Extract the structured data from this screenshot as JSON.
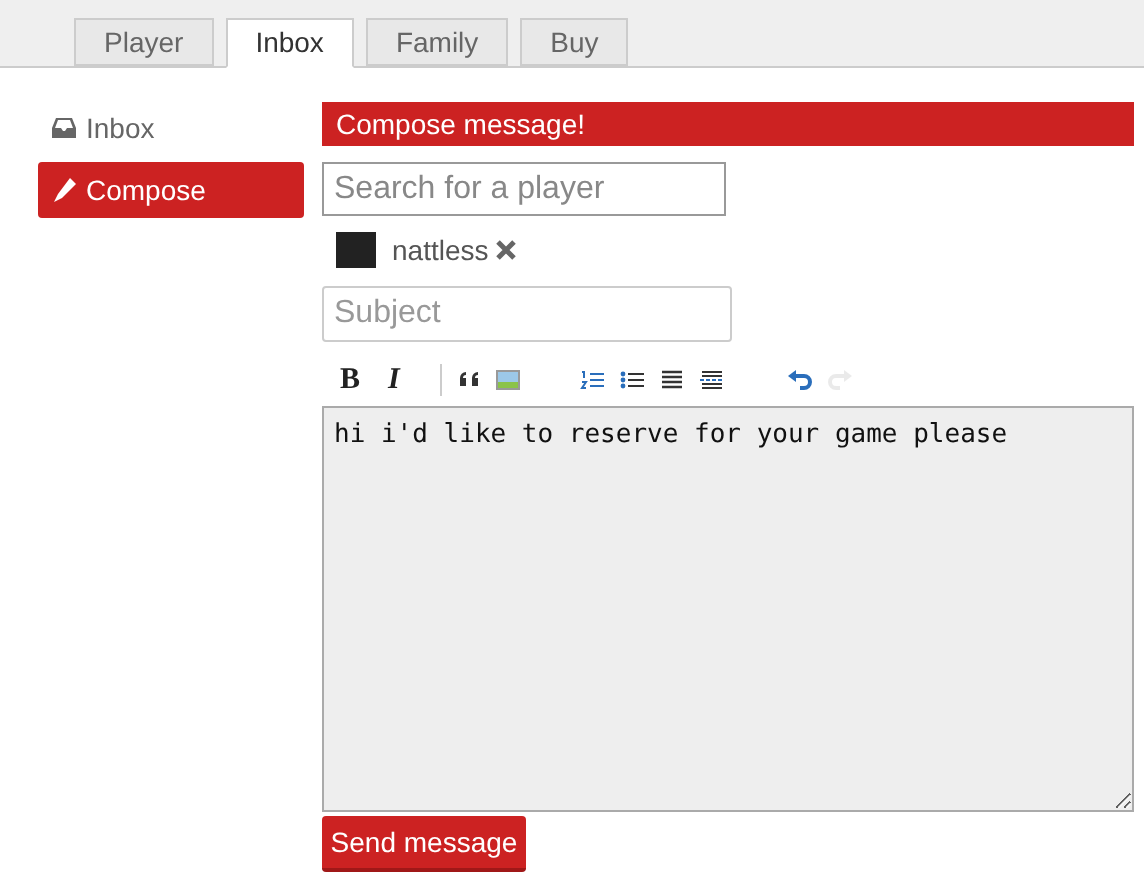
{
  "tabs": [
    {
      "label": "Player",
      "selected": false
    },
    {
      "label": "Inbox",
      "selected": true
    },
    {
      "label": "Family",
      "selected": false
    },
    {
      "label": "Buy",
      "selected": false
    }
  ],
  "sidebar": {
    "items": [
      {
        "label": "Inbox",
        "kind": "inbox",
        "selected": false
      },
      {
        "label": "Compose",
        "kind": "compose",
        "selected": true
      }
    ]
  },
  "compose": {
    "header": "Compose message!",
    "search": {
      "placeholder": "Search for a player"
    },
    "recipients": [
      {
        "name": "nattless"
      }
    ],
    "subject": {
      "placeholder": "Subject"
    },
    "toolbar": [
      {
        "kind": "bold",
        "glyph": "B"
      },
      {
        "kind": "italic",
        "glyph": "I"
      },
      {
        "kind": "separator"
      },
      {
        "kind": "quote"
      },
      {
        "kind": "image"
      },
      {
        "kind": "ordered-list"
      },
      {
        "kind": "bullet-list"
      },
      {
        "kind": "align"
      },
      {
        "kind": "rule"
      },
      {
        "kind": "undo",
        "disabled": false
      },
      {
        "kind": "redo",
        "disabled": true
      }
    ],
    "body": "hi i'd like to reserve for your game please",
    "send_button": "Send message"
  }
}
